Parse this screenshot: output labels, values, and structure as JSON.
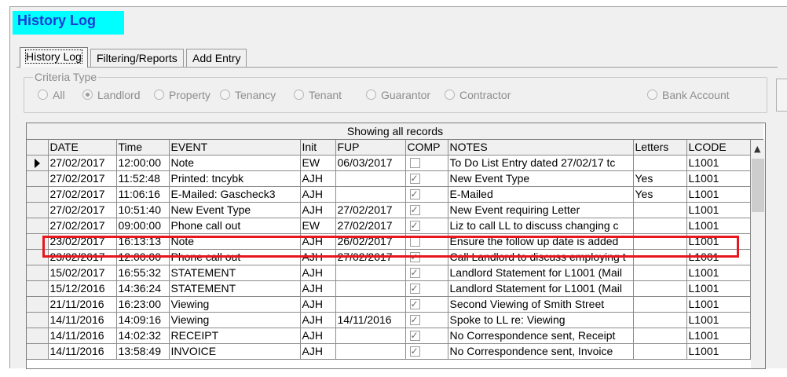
{
  "window": {
    "title": "History Log"
  },
  "tabs": [
    {
      "label": "History Log",
      "active": true
    },
    {
      "label": "Filtering/Reports",
      "active": false
    },
    {
      "label": "Add Entry",
      "active": false
    }
  ],
  "criteria": {
    "legend": "Criteria Type",
    "options": [
      "All",
      "Landlord",
      "Property",
      "Tenancy",
      "Tenant",
      "Guarantor",
      "Contractor",
      "Bank Account"
    ],
    "selected": "Landlord"
  },
  "grid": {
    "caption": "Showing all records",
    "columns": [
      "DATE",
      "Time",
      "EVENT",
      "Init",
      "FUP",
      "COMP",
      "NOTES",
      "Letters",
      "LCODE"
    ],
    "rows": [
      {
        "date": "27/02/2017",
        "time": "12:00:00",
        "event": "Note",
        "init": "EW",
        "fup": "06/03/2017",
        "comp": false,
        "notes": "To Do List Entry dated 27/02/17 tc",
        "letters": "",
        "lcode": "L1001",
        "current": true
      },
      {
        "date": "27/02/2017",
        "time": "11:52:48",
        "event": "Printed: tncybk",
        "init": "AJH",
        "fup": "",
        "comp": true,
        "notes": "New Event Type",
        "letters": "Yes",
        "lcode": "L1001"
      },
      {
        "date": "27/02/2017",
        "time": "11:06:16",
        "event": "E-Mailed: Gascheck3",
        "init": "AJH",
        "fup": "",
        "comp": true,
        "notes": "E-Mailed",
        "letters": "Yes",
        "lcode": "L1001"
      },
      {
        "date": "27/02/2017",
        "time": "10:51:40",
        "event": "New Event Type",
        "init": "AJH",
        "fup": "27/02/2017",
        "comp": true,
        "notes": "New Event requiring Letter",
        "letters": "",
        "lcode": "L1001"
      },
      {
        "date": "27/02/2017",
        "time": "09:00:00",
        "event": "Phone call out",
        "init": "EW",
        "fup": "27/02/2017",
        "comp": true,
        "notes": "Liz to call LL to discuss changing c",
        "letters": "",
        "lcode": "L1001"
      },
      {
        "date": "23/02/2017",
        "time": "16:13:13",
        "event": "Note",
        "init": "AJH",
        "fup": "26/02/2017",
        "comp": false,
        "notes": "Ensure the follow up date is added",
        "letters": "",
        "lcode": "L1001",
        "highlighted": true
      },
      {
        "date": "23/02/2017",
        "time": "12:00:00",
        "event": "Phone call out",
        "init": "AJH",
        "fup": "27/02/2017",
        "comp": true,
        "notes": "Call Landlord to discuss employing t",
        "letters": "",
        "lcode": "L1001"
      },
      {
        "date": "15/02/2017",
        "time": "16:55:32",
        "event": "STATEMENT",
        "init": "AJH",
        "fup": "",
        "comp": true,
        "notes": "Landlord Statement for L1001 (Mail",
        "letters": "",
        "lcode": "L1001"
      },
      {
        "date": "15/12/2016",
        "time": "14:36:24",
        "event": "STATEMENT",
        "init": "AJH",
        "fup": "",
        "comp": true,
        "notes": "Landlord Statement for L1001 (Mail",
        "letters": "",
        "lcode": "L1001"
      },
      {
        "date": "21/11/2016",
        "time": "16:23:00",
        "event": "Viewing",
        "init": "AJH",
        "fup": "",
        "comp": true,
        "notes": "Second Viewing of Smith Street",
        "letters": "",
        "lcode": "L1001"
      },
      {
        "date": "14/11/2016",
        "time": "14:09:16",
        "event": "Viewing",
        "init": "AJH",
        "fup": "14/11/2016",
        "comp": true,
        "notes": "Spoke to LL re: Viewing",
        "letters": "",
        "lcode": "L1001"
      },
      {
        "date": "14/11/2016",
        "time": "14:02:32",
        "event": "RECEIPT",
        "init": "AJH",
        "fup": "",
        "comp": true,
        "notes": "No Correspondence sent,  Receipt",
        "letters": "",
        "lcode": "L1001"
      },
      {
        "date": "14/11/2016",
        "time": "13:58:49",
        "event": "INVOICE",
        "init": "AJH",
        "fup": "",
        "comp": true,
        "notes": "No Correspondence sent,  Invoice",
        "letters": "",
        "lcode": "L1001"
      }
    ]
  },
  "colors": {
    "title_bg": "#00ffff",
    "title_text": "#1a3bd6",
    "highlight": "#e8161e"
  }
}
